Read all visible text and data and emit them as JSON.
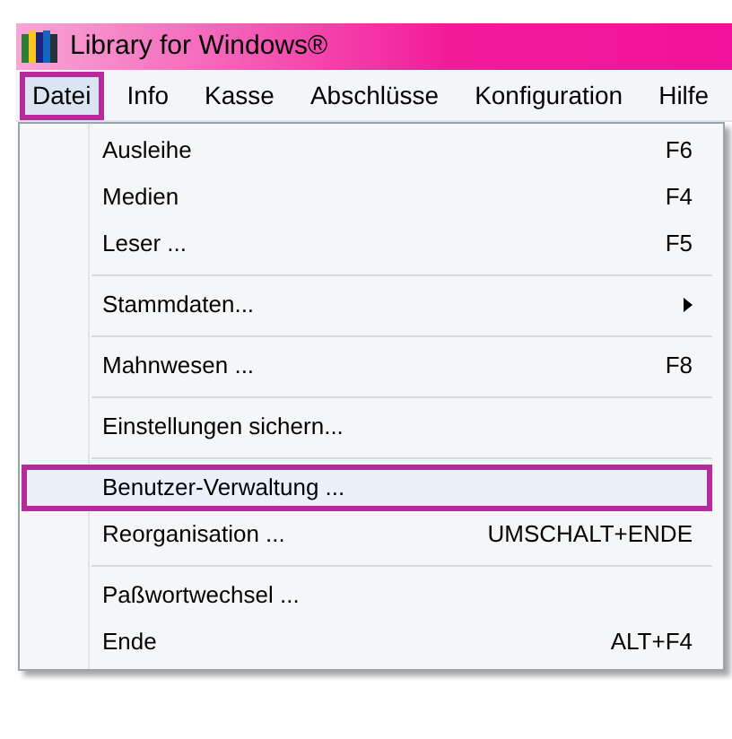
{
  "window": {
    "title": "Library for Windows®"
  },
  "menubar": [
    {
      "label": "Datei",
      "selected": true
    },
    {
      "label": "Info",
      "selected": false
    },
    {
      "label": "Kasse",
      "selected": false
    },
    {
      "label": "Abschlüsse",
      "selected": false
    },
    {
      "label": "Konfiguration",
      "selected": false
    },
    {
      "label": "Hilfe",
      "selected": false
    }
  ],
  "menu": [
    {
      "kind": "item",
      "label": "Ausleihe",
      "shortcut": "F6",
      "highlighted": false
    },
    {
      "kind": "item",
      "label": "Medien",
      "shortcut": "F4",
      "highlighted": false
    },
    {
      "kind": "item",
      "label": "Leser ...",
      "shortcut": "F5",
      "highlighted": false
    },
    {
      "kind": "separator"
    },
    {
      "kind": "submenu",
      "label": "Stammdaten...",
      "highlighted": false
    },
    {
      "kind": "separator"
    },
    {
      "kind": "item",
      "label": "Mahnwesen ...",
      "shortcut": "F8",
      "highlighted": false
    },
    {
      "kind": "separator"
    },
    {
      "kind": "item",
      "label": "Einstellungen sichern...",
      "highlighted": false
    },
    {
      "kind": "separator"
    },
    {
      "kind": "item",
      "label": "Benutzer-Verwaltung ...",
      "highlighted": true
    },
    {
      "kind": "item",
      "label": "Reorganisation ...",
      "shortcut": "UMSCHALT+ENDE",
      "highlighted": false
    },
    {
      "kind": "separator"
    },
    {
      "kind": "item",
      "label": "Paßwortwechsel ...",
      "highlighted": false
    },
    {
      "kind": "item",
      "label": "Ende",
      "shortcut": "ALT+F4",
      "highlighted": false
    }
  ]
}
